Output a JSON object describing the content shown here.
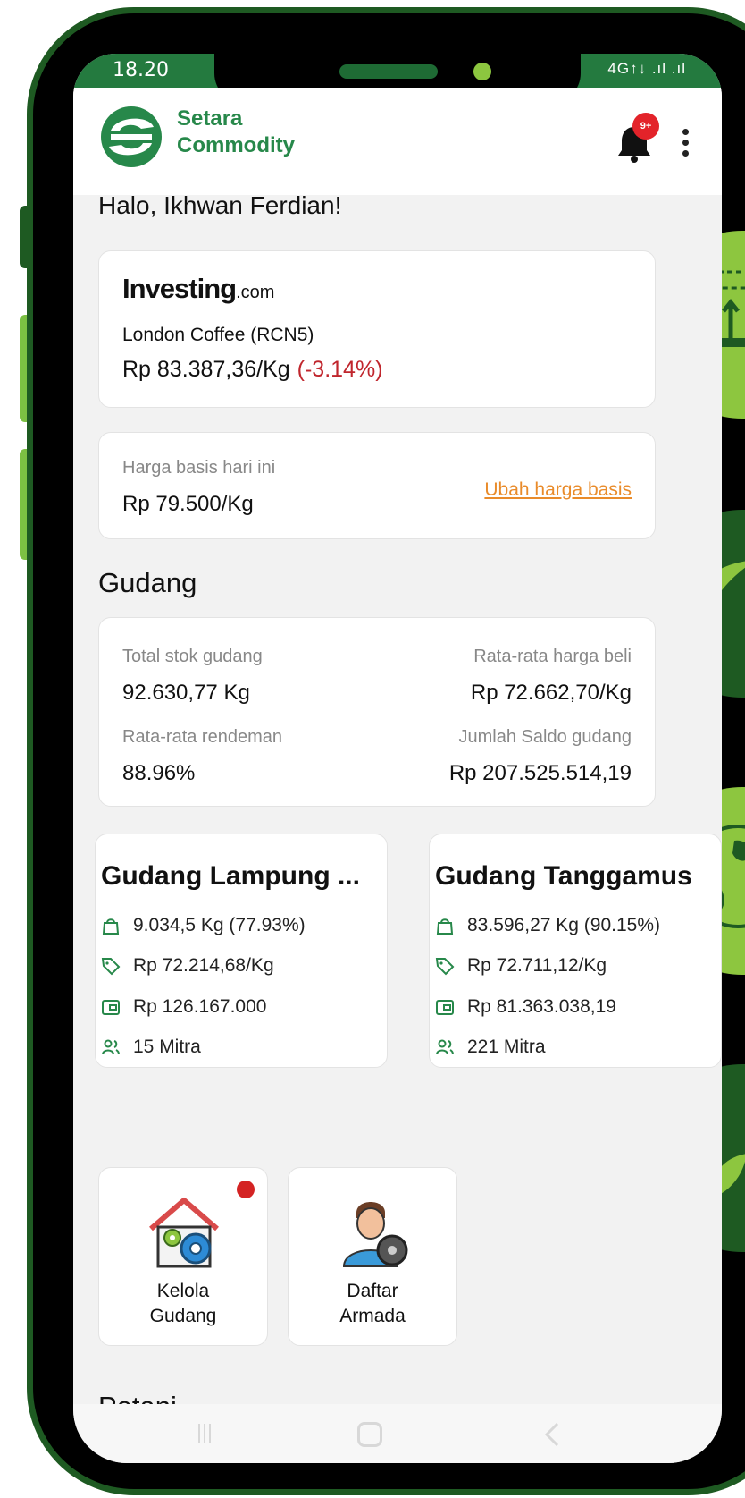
{
  "status_bar": {
    "time": "18.20",
    "indicators": "4G↑↓ .ıl .ıl"
  },
  "app": {
    "name_line1": "Setara",
    "name_line2": "Commodity",
    "notification_count": "9+"
  },
  "greeting": "Halo, Ikhwan Ferdian!",
  "market": {
    "provider": "Investing",
    "provider_suffix": ".com",
    "commodity": "London Coffee (RCN5)",
    "price": "Rp 83.387,36/Kg",
    "change": "(-3.14%)"
  },
  "basis": {
    "label": "Harga basis hari ini",
    "value": "Rp 79.500/Kg",
    "action": "Ubah harga basis"
  },
  "gudang": {
    "title": "Gudang",
    "stats": {
      "total_stock_label": "Total stok gudang",
      "total_stock_value": "92.630,77 Kg",
      "avg_buy_label": "Rata-rata harga beli",
      "avg_buy_value": "Rp 72.662,70/Kg",
      "avg_yield_label": "Rata-rata rendeman",
      "avg_yield_value": "88.96%",
      "balance_label": "Jumlah Saldo gudang",
      "balance_value": "Rp 207.525.514,19"
    },
    "warehouses": [
      {
        "name": "Gudang Lampung ...",
        "stock": "9.034,5 Kg (77.93%)",
        "price": "Rp 72.214,68/Kg",
        "balance": "Rp 126.167.000",
        "partners": "15 Mitra"
      },
      {
        "name": "Gudang Tanggamus",
        "stock": "83.596,27 Kg (90.15%)",
        "price": "Rp 72.711,12/Kg",
        "balance": "Rp 81.363.038,19",
        "partners": "221 Mitra"
      }
    ]
  },
  "tiles": [
    {
      "label_line1": "Kelola",
      "label_line2": "Gudang",
      "has_notification": true
    },
    {
      "label_line1": "Daftar",
      "label_line2": "Armada",
      "has_notification": false
    }
  ],
  "petani": {
    "title": "Petani"
  },
  "colors": {
    "brand_green": "#27884a",
    "dark_green": "#1e5a22",
    "light_green": "#8dc63f",
    "negative": "#c0262d",
    "link_orange": "#e98b2a",
    "alert_red": "#e3232a"
  },
  "icons": [
    "bell-icon",
    "kebab-menu-icon",
    "bag-icon",
    "tag-icon",
    "wallet-icon",
    "users-icon",
    "warehouse-gear-icon",
    "driver-icon"
  ]
}
